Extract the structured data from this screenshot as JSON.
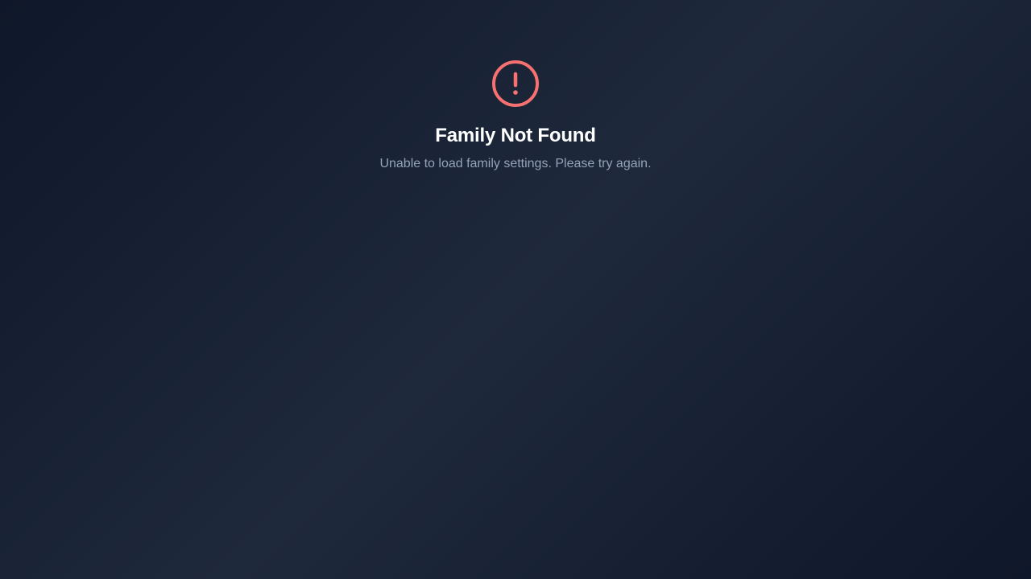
{
  "error": {
    "icon": "alert-circle-icon",
    "icon_color": "#f87171",
    "title": "Family Not Found",
    "message": "Unable to load family settings. Please try again."
  },
  "colors": {
    "background_from": "#0f172a",
    "background_mid": "#1e293b",
    "title": "#ffffff",
    "message": "#94a3b8"
  }
}
